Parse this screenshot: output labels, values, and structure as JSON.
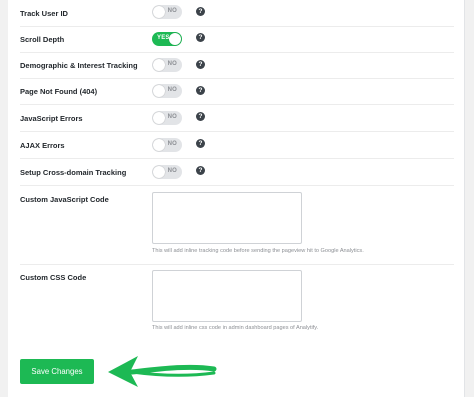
{
  "settings": [
    {
      "label": "Track User ID",
      "state": "NO",
      "on": false
    },
    {
      "label": "Scroll Depth",
      "state": "YES",
      "on": true
    },
    {
      "label": "Demographic & Interest Tracking",
      "state": "NO",
      "on": false
    },
    {
      "label": "Page Not Found (404)",
      "state": "NO",
      "on": false
    },
    {
      "label": "JavaScript Errors",
      "state": "NO",
      "on": false
    },
    {
      "label": "AJAX Errors",
      "state": "NO",
      "on": false
    },
    {
      "label": "Setup Cross-domain Tracking",
      "state": "NO",
      "on": false
    }
  ],
  "help_glyph": "?",
  "custom_js": {
    "label": "Custom JavaScript Code",
    "value": "",
    "hint": "This will add inline tracking code before sending the pageview hit to Google Analytics."
  },
  "custom_css": {
    "label": "Custom CSS Code",
    "value": "",
    "hint": "This will add inline css code in admin dashboard pages of Analytify."
  },
  "save_button": {
    "label": "Save Changes"
  },
  "colors": {
    "accent_green": "#1db954",
    "toggle_off": "#e2e4e7",
    "help_icon": "#3c434a"
  },
  "icons": {
    "help": "question-circle-icon",
    "pointer": "green-arrow-icon"
  }
}
